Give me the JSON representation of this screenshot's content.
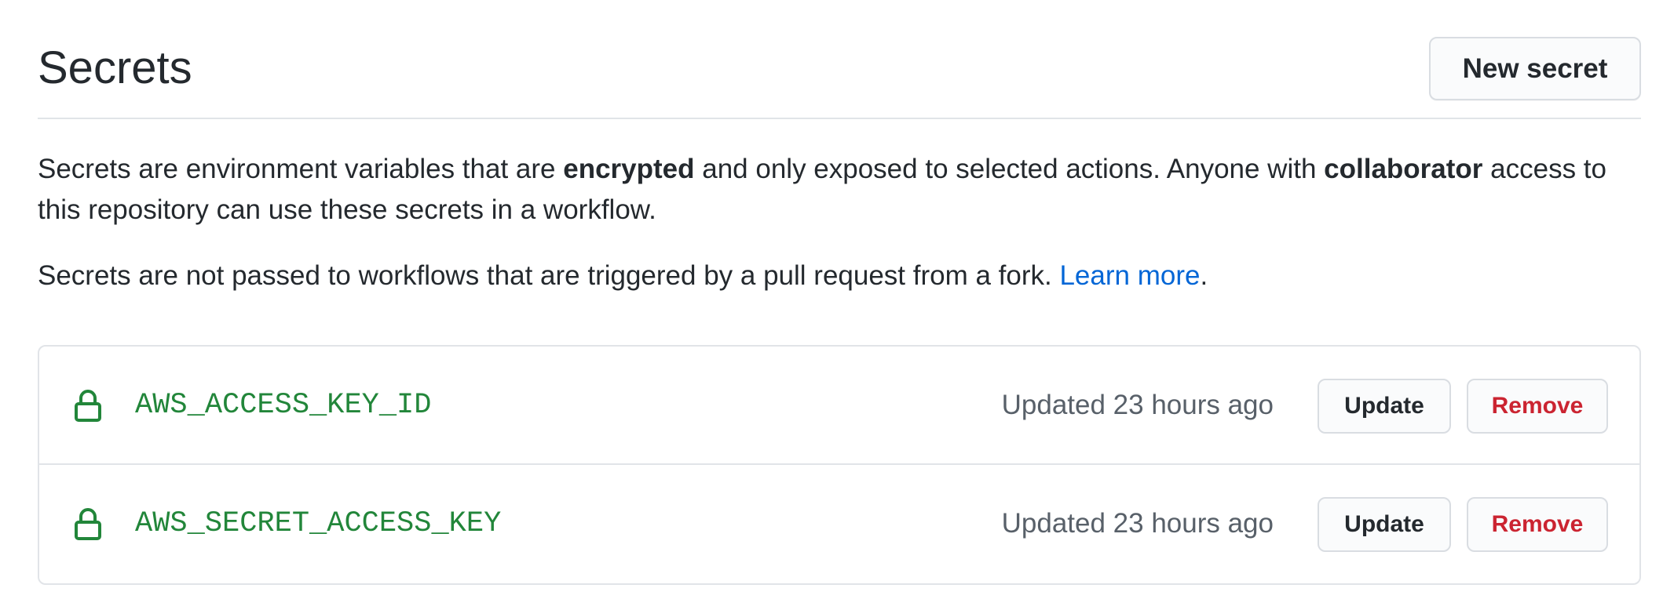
{
  "header": {
    "title": "Secrets",
    "new_secret_label": "New secret"
  },
  "description": {
    "part1": "Secrets are environment variables that are ",
    "bold1": "encrypted",
    "part2": " and only exposed to selected actions. Anyone with ",
    "bold2": "collaborator",
    "part3": " access to this repository can use these secrets in a workflow."
  },
  "fork_note": {
    "text": "Secrets are not passed to workflows that are triggered by a pull request from a fork. ",
    "link": "Learn more",
    "end": "."
  },
  "secrets": [
    {
      "icon": "lock-icon",
      "name": "AWS_ACCESS_KEY_ID",
      "updated": "Updated 23 hours ago",
      "update_label": "Update",
      "remove_label": "Remove"
    },
    {
      "icon": "lock-icon",
      "name": "AWS_SECRET_ACCESS_KEY",
      "updated": "Updated 23 hours ago",
      "update_label": "Update",
      "remove_label": "Remove"
    }
  ],
  "colors": {
    "text": "#24292e",
    "muted": "#586069",
    "link": "#0366d6",
    "secret_name": "#22863a",
    "danger": "#cb2431",
    "border": "#e1e4e8"
  }
}
